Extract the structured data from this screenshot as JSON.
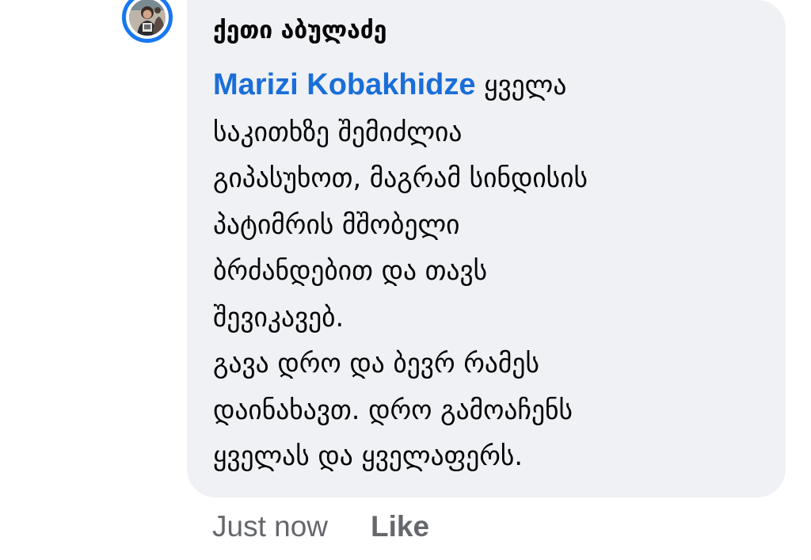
{
  "comment": {
    "author": "ქეთი აბულაძე",
    "mention": "Marizi Kobakhidze",
    "lines": [
      "ყველა",
      "საკითხზე შემიძლია",
      "გიპასუხოთ, მაგრამ სინდისის",
      "პატიმრის მშობელი",
      "ბრძანდებით და თავს",
      "შევიკავებ.",
      "გავა დრო და ბევრ რამეს",
      "დაინახავთ. დრო გამოაჩენს",
      "ყველას და ყველაფერს."
    ]
  },
  "actions": {
    "timestamp": "Just now",
    "like_label": "Like"
  },
  "colors": {
    "bubble": "#f0f1f5",
    "mention": "#1a6ed8",
    "avatar_ring": "#1877f2",
    "muted": "#65676b"
  },
  "icons": {
    "avatar": "profile-photo"
  }
}
